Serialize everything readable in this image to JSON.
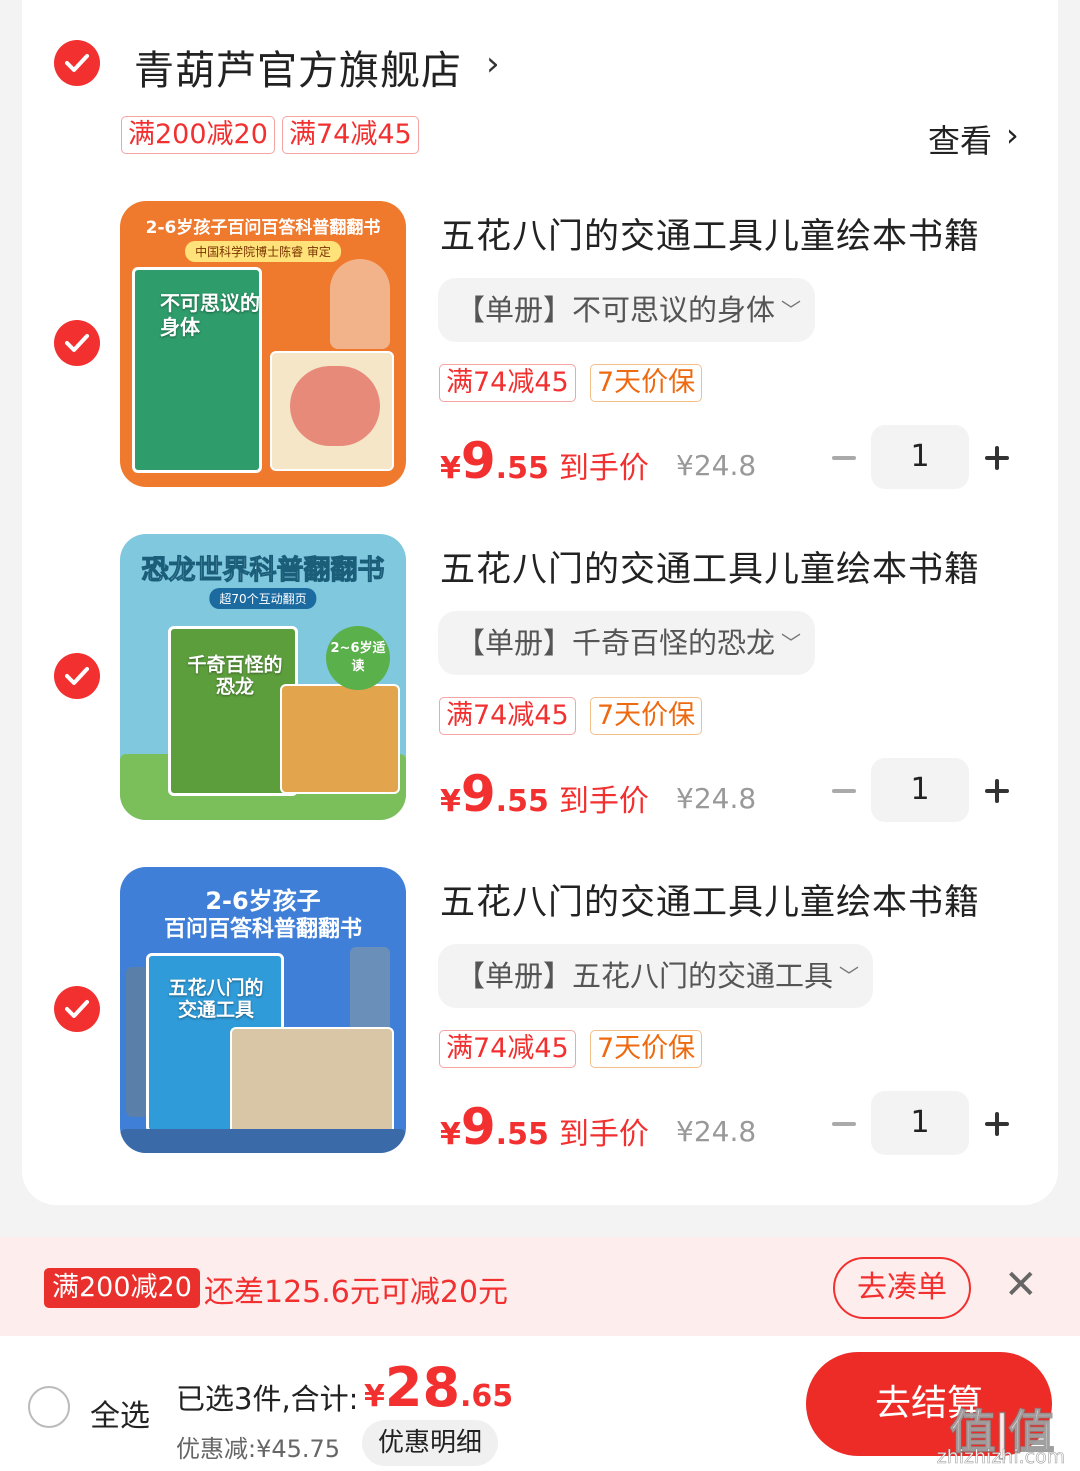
{
  "store": {
    "name": "青葫芦官方旗舰店",
    "chevron": "›",
    "promo_tags": [
      "满200减20",
      "满74减45"
    ],
    "view_more": "查看",
    "view_chevron": "›"
  },
  "products": [
    {
      "title": "五花八门的交通工具儿童绘本书籍",
      "variant": "【单册】不可思议的身体",
      "tags": [
        "满74减45",
        "7天价保"
      ],
      "price_yen": "¥",
      "price_int": "9",
      "price_dec": ".55",
      "price_label": "到手价",
      "original_price": "¥24.8",
      "quantity": "1",
      "thumb": {
        "top_text": "2-6岁孩子百问百答科普翻翻书",
        "sub_text": "中国科学院博士陈睿 审定",
        "book_text": "不可思议的身体",
        "bg": "#ef7a2e"
      }
    },
    {
      "title": "五花八门的交通工具儿童绘本书籍",
      "variant": "【单册】千奇百怪的恐龙",
      "tags": [
        "满74减45",
        "7天价保"
      ],
      "price_yen": "¥",
      "price_int": "9",
      "price_dec": ".55",
      "price_label": "到手价",
      "original_price": "¥24.8",
      "quantity": "1",
      "thumb": {
        "top_text": "恐龙世界科普翻翻书",
        "sub_text": "超70个互动翻页",
        "book_text": "千奇百怪的恐龙",
        "badge": "2~6岁适读",
        "bg": "#7fc8dd"
      }
    },
    {
      "title": "五花八门的交通工具儿童绘本书籍",
      "variant": "【单册】五花八门的交通工具",
      "tags": [
        "满74减45",
        "7天价保"
      ],
      "price_yen": "¥",
      "price_int": "9",
      "price_dec": ".55",
      "price_label": "到手价",
      "original_price": "¥24.8",
      "quantity": "1",
      "thumb": {
        "top_text": "2-6岁孩子",
        "top_text2": "百问百答科普翻翻书",
        "book_text": "五花八门的交通工具",
        "bg": "#3f7fd8"
      }
    }
  ],
  "promo_bar": {
    "tag": "满200减20",
    "text": "还差125.6元可减20元",
    "button": "去凑单",
    "close": "✕"
  },
  "bottom": {
    "select_all": "全选",
    "summary": "已选3件,合计:",
    "total_yen": "¥",
    "total_int": "28",
    "total_dec": ".65",
    "discount": "优惠减:¥45.75",
    "detail_button": "优惠明细",
    "checkout": "去结算",
    "watermark": "值|值",
    "watermark_sub": "zhizhizhi.com"
  },
  "colors": {
    "accent": "#f23030",
    "checkout": "#ed2c28",
    "promo_bg": "#fdeeed",
    "tag_orange": "#ee6a10"
  }
}
